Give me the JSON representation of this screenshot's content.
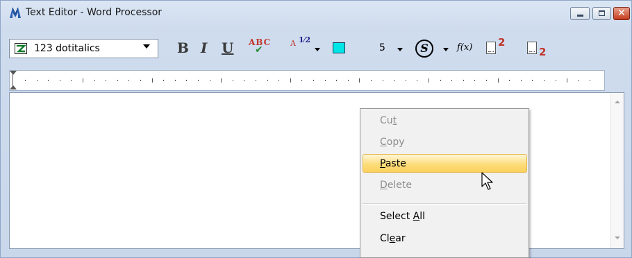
{
  "window": {
    "title": "Text Editor - Word Processor",
    "controls": {
      "close_glyph": "✕"
    }
  },
  "toolbar": {
    "font_combo_value": "123 dotitalics",
    "bold_label": "B",
    "italic_label": "I",
    "underline_label": "U",
    "spell_label": "ABC",
    "fraction_label_a": "A",
    "fraction_label": "1⁄2",
    "color_swatch": "#00E5E5",
    "size_value": "5",
    "symbol_label": "S",
    "function_label": "f(x)",
    "superscript_number": "2",
    "subscript_number": "2"
  },
  "context_menu": {
    "items": [
      {
        "label": "Cut",
        "state": "disabled"
      },
      {
        "label": "Copy",
        "state": "disabled"
      },
      {
        "label": "Paste",
        "state": "highlighted"
      },
      {
        "label": "Delete",
        "state": "disabled"
      },
      {
        "label": "Select All",
        "state": "enabled"
      },
      {
        "label": "Clear",
        "state": "enabled"
      }
    ]
  },
  "colors": {
    "window_bg": "#CFDCEE",
    "menu_highlight": "#FDDD7C",
    "disabled_text": "#8D8D8D"
  }
}
